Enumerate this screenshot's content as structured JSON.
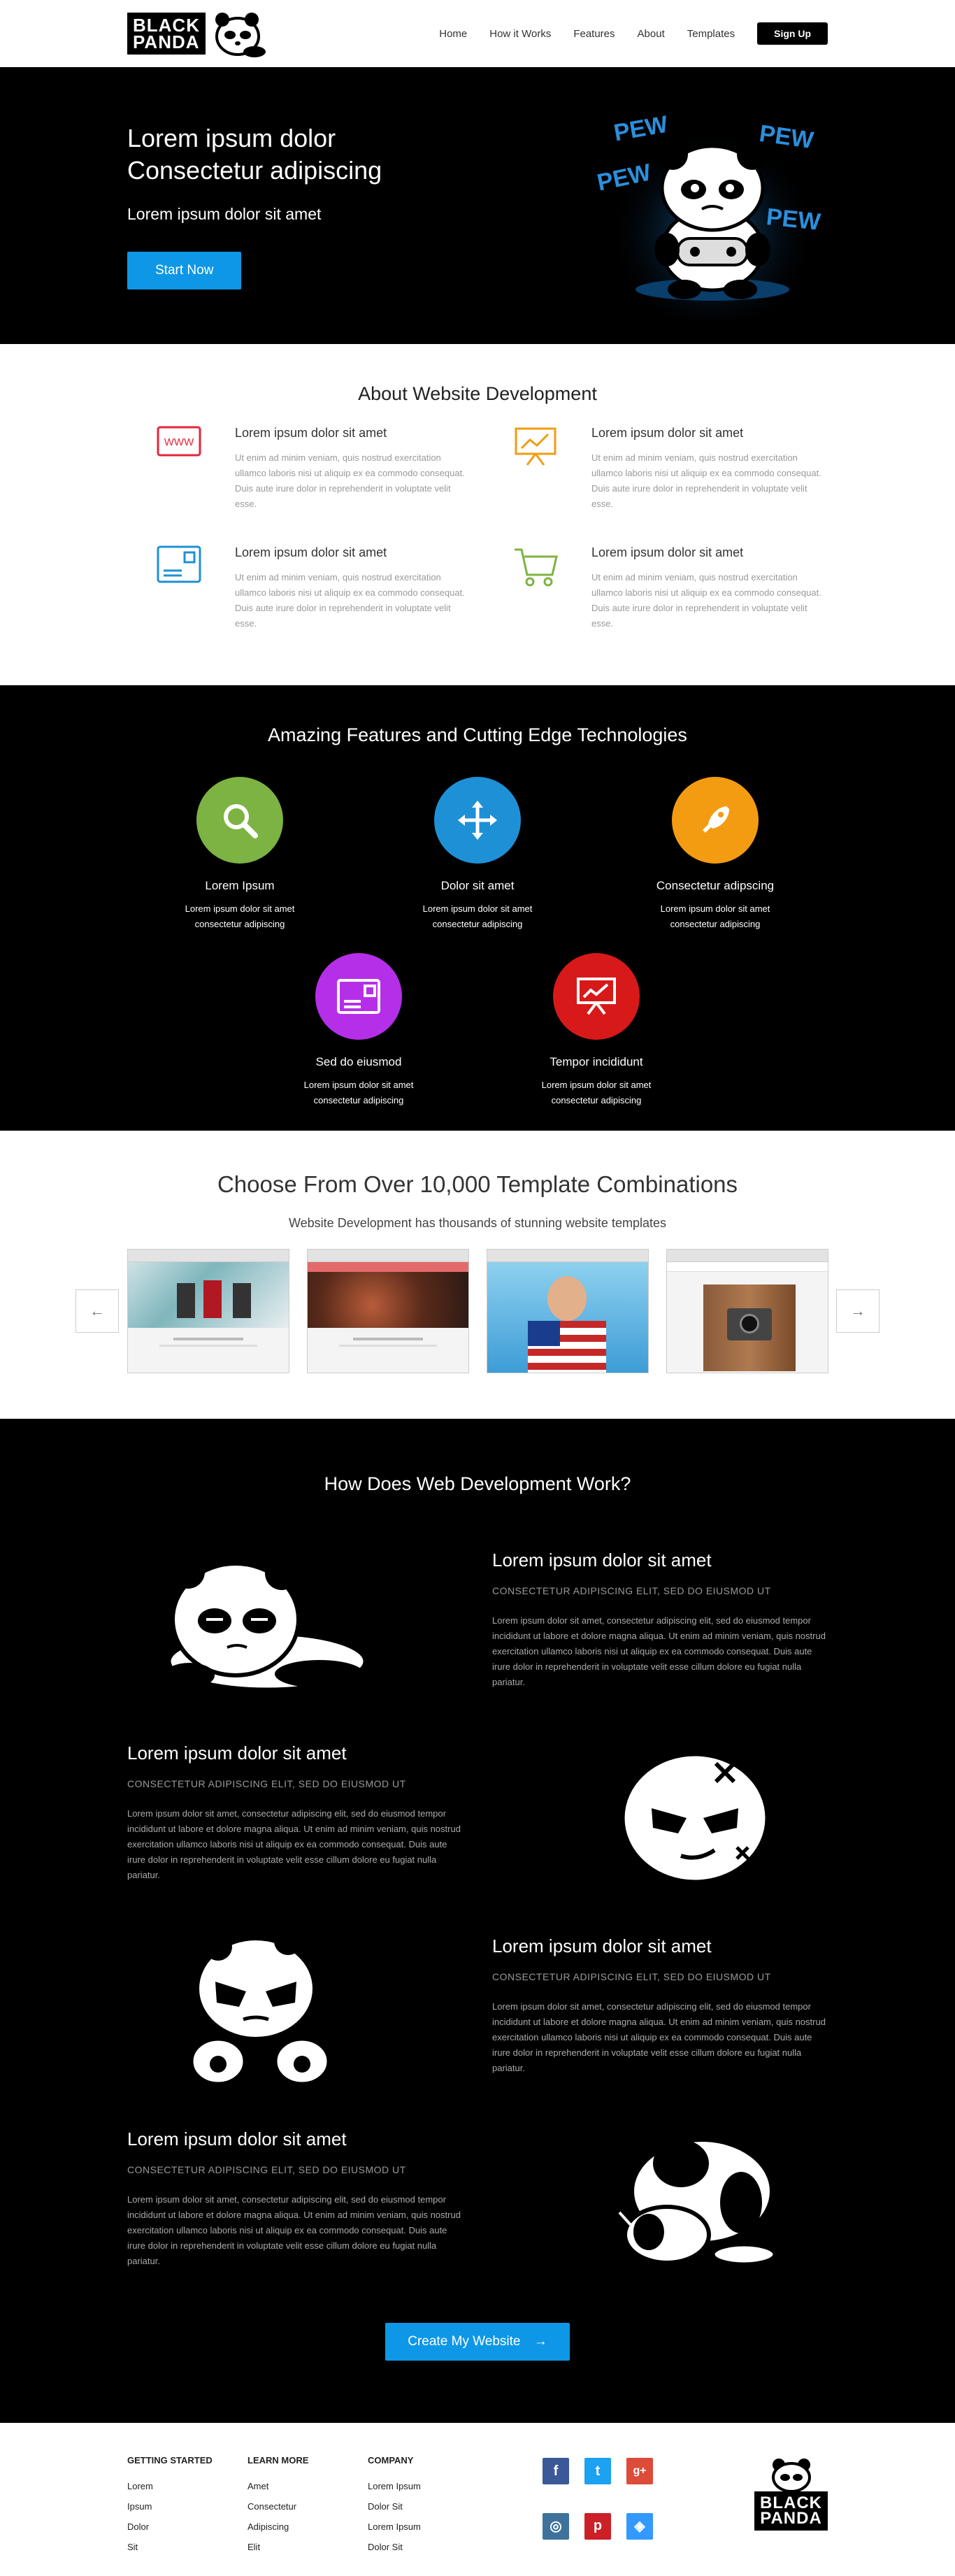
{
  "brand": {
    "line1": "BLACK",
    "line2": "PANDA"
  },
  "nav": {
    "items": [
      "Home",
      "How it Works",
      "Features",
      "About",
      "Templates"
    ],
    "signup": "Sign Up"
  },
  "hero": {
    "title_line1": "Lorem ipsum dolor",
    "title_line2": "Consectetur adipiscing",
    "subtitle": "Lorem ipsum dolor sit amet",
    "cta": "Start Now",
    "pew": "PEW"
  },
  "about": {
    "title": "About Website Development",
    "items": [
      {
        "icon": "www-icon",
        "color": "#e2263a",
        "title": "Lorem ipsum dolor sit amet",
        "text": "Ut enim ad minim veniam, quis nostrud exercitation ullamco laboris nisi ut aliquip ex ea commodo consequat. Duis aute irure dolor in reprehenderit in voluptate velit esse."
      },
      {
        "icon": "presentation-chart-icon",
        "color": "#f39c12",
        "title": "Lorem ipsum dolor sit amet",
        "text": "Ut enim ad minim veniam, quis nostrud exercitation ullamco laboris nisi ut aliquip ex ea commodo consequat. Duis aute irure dolor in reprehenderit in voluptate velit esse."
      },
      {
        "icon": "browser-window-icon",
        "color": "#1e90d6",
        "title": "Lorem ipsum dolor sit amet",
        "text": "Ut enim ad minim veniam, quis nostrud exercitation ullamco laboris nisi ut aliquip ex ea commodo consequat. Duis aute irure dolor in reprehenderit in voluptate velit esse."
      },
      {
        "icon": "shopping-cart-icon",
        "color": "#7cb342",
        "title": "Lorem ipsum dolor sit amet",
        "text": "Ut enim ad minim veniam, quis nostrud exercitation ullamco laboris nisi ut aliquip ex ea commodo consequat. Duis aute irure dolor in reprehenderit in voluptate velit esse."
      }
    ]
  },
  "features": {
    "title": "Amazing Features and Cutting Edge Technologies",
    "items": [
      {
        "icon": "search-icon",
        "color": "#7cb342",
        "title": "Lorem Ipsum",
        "line1": "Lorem ipsum dolor sit amet",
        "line2": "consectetur adipiscing"
      },
      {
        "icon": "move-arrows-icon",
        "color": "#1e90d6",
        "title": "Dolor sit amet",
        "line1": "Lorem ipsum dolor sit amet",
        "line2": "consectetur adipiscing"
      },
      {
        "icon": "rocket-icon",
        "color": "#f39c12",
        "title": "Consectetur adipscing",
        "line1": "Lorem ipsum dolor sit amet",
        "line2": "consectetur adipiscing"
      },
      {
        "icon": "postcard-icon",
        "color": "#b52fe8",
        "title": "Sed do eiusmod",
        "line1": "Lorem ipsum dolor sit amet",
        "line2": "consectetur adipiscing"
      },
      {
        "icon": "presentation-board-icon",
        "color": "#d81919",
        "title": "Tempor incididunt",
        "line1": "Lorem ipsum dolor sit amet",
        "line2": "consectetur adipiscing"
      }
    ]
  },
  "templates": {
    "title": "Choose From Over 10,000 Template Combinations",
    "subtitle": "Website Development has thousands of stunning website templates",
    "prev": "←",
    "next": "→"
  },
  "how": {
    "title": "How Does Web Development Work?",
    "steps": [
      {
        "title": "Lorem ipsum dolor sit amet",
        "kicker": "CONSECTETUR ADIPISCING ELIT, SED DO EIUSMOD UT",
        "text": "Lorem ipsum dolor sit amet, consectetur adipiscing elit, sed do eiusmod tempor incididunt ut labore et dolore magna aliqua. Ut enim ad minim veniam, quis nostrud exercitation ullamco laboris nisi ut aliquip ex ea commodo consequat. Duis aute irure dolor in reprehenderit in voluptate velit esse cillum dolore eu fugiat nulla pariatur."
      },
      {
        "title": "Lorem ipsum dolor sit amet",
        "kicker": "CONSECTETUR ADIPISCING ELIT, SED DO EIUSMOD UT",
        "text": "Lorem ipsum dolor sit amet, consectetur adipiscing elit, sed do eiusmod tempor incididunt ut labore et dolore magna aliqua. Ut enim ad minim veniam, quis nostrud exercitation ullamco laboris nisi ut aliquip ex ea commodo consequat. Duis aute irure dolor in reprehenderit in voluptate velit esse cillum dolore eu fugiat nulla pariatur."
      },
      {
        "title": "Lorem ipsum dolor sit amet",
        "kicker": "CONSECTETUR ADIPISCING ELIT, SED DO EIUSMOD UT",
        "text": "Lorem ipsum dolor sit amet, consectetur adipiscing elit, sed do eiusmod tempor incididunt ut labore et dolore magna aliqua. Ut enim ad minim veniam, quis nostrud exercitation ullamco laboris nisi ut aliquip ex ea commodo consequat. Duis aute irure dolor in reprehenderit in voluptate velit esse cillum dolore eu fugiat nulla pariatur."
      },
      {
        "title": "Lorem ipsum dolor sit amet",
        "kicker": "CONSECTETUR ADIPISCING ELIT, SED DO EIUSMOD UT",
        "text": "Lorem ipsum dolor sit amet, consectetur adipiscing elit, sed do eiusmod tempor incididunt ut labore et dolore magna aliqua. Ut enim ad minim veniam, quis nostrud exercitation ullamco laboris nisi ut aliquip ex ea commodo consequat. Duis aute irure dolor in reprehenderit in voluptate velit esse cillum dolore eu fugiat nulla pariatur."
      }
    ],
    "cta": "Create My Website",
    "cta_arrow": "→"
  },
  "footer": {
    "cols": [
      {
        "title": "GETTING STARTED",
        "links": [
          "Lorem",
          "Ipsum",
          "Dolor",
          "Sit"
        ]
      },
      {
        "title": "LEARN MORE",
        "links": [
          "Amet",
          "Consectetur",
          "Adipiscing",
          "Elit"
        ]
      },
      {
        "title": "COMPANY",
        "links": [
          "Lorem Ipsum",
          "Dolor Sit",
          "Lorem Ipsum",
          "Dolor Sit"
        ]
      }
    ],
    "social": [
      {
        "icon": "facebook-icon",
        "glyph": "f",
        "color": "#3b5998"
      },
      {
        "icon": "twitter-icon",
        "glyph": "t",
        "color": "#1da1f2"
      },
      {
        "icon": "google-plus-icon",
        "glyph": "g+",
        "color": "#dd4b39"
      },
      {
        "icon": "instagram-icon",
        "glyph": "◎",
        "color": "#3f729b"
      },
      {
        "icon": "pinterest-icon",
        "glyph": "p",
        "color": "#cb2027"
      },
      {
        "icon": "delicious-icon",
        "glyph": "◈",
        "color": "#3399ff"
      }
    ]
  }
}
